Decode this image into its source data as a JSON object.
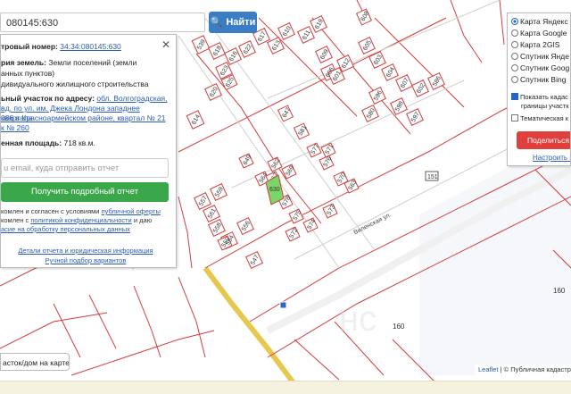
{
  "search": {
    "value": "080145:630",
    "button_label": "Найти"
  },
  "info_panel": {
    "cadastral_label": "тровый номер:",
    "cadastral_value": "34:34:080145:630",
    "category_label": "рия земель:",
    "category_value": "Земли поселений (земли",
    "category_value2": "анных пунктов)",
    "usage_value": "дивидуального жилищного строительства",
    "address_label": "ьный участок по адресу:",
    "address_line1": "обл. Волгоградская, г",
    "address_line2": "ад, по ул. им. Джека Лондона западнее квартала",
    "address_line3": "086 в Красноармейском районе, квартал № 21",
    "address_line4": "к № 260",
    "area_label": "енная площадь:",
    "area_value": "718 кв.м.",
    "email_placeholder": "u email, куда отправить отчет",
    "report_button": "Получить подробный отчет",
    "consent1": "комлен и согласен с условиями",
    "consent1_link": "публичной оферты",
    "consent2": "комлен с",
    "consent2_link": "политикой конфиденциальности",
    "consent2_tail": "и даю",
    "consent3_link": "асие на обработку персональных данных",
    "details_link": "Детали отчета и юридическая информация",
    "manual_link": "Ручной подбор вариантов"
  },
  "layers": {
    "options": [
      "Карта Яндекс",
      "Карта Google",
      "Карта 2GIS",
      "Спутник Янде",
      "Спутник Goog",
      "Спутник Bing"
    ],
    "selected": 0,
    "check1_line1": "Показать кадас",
    "check1_line2": "границы участк",
    "check2": "Тематическая к",
    "share_button": "Поделиться сс",
    "setup_link": "Настроить карт"
  },
  "question_button": "асток/дом на карте?",
  "attribution": {
    "leaflet": "Leaflet",
    "rest": "| © Публичная кадастр"
  },
  "map": {
    "road_label": "Виленская ул.",
    "road_badge": "151",
    "big_labels": [
      "160",
      "160"
    ],
    "selected_plot": "630",
    "plots": [
      "539",
      "618",
      "616",
      "623",
      "625",
      "620",
      "614",
      "610",
      "622",
      "617",
      "613",
      "611",
      "619",
      "609",
      "606",
      "612",
      "608",
      "605",
      "603",
      "604",
      "607",
      "602",
      "586",
      "601",
      "596",
      "598",
      "597",
      "580",
      "581",
      "577",
      "576",
      "570",
      "563",
      "571",
      "564",
      "562",
      "569",
      "567",
      "578",
      "575",
      "573",
      "574",
      "572",
      "649",
      "647",
      "559",
      "557",
      "561",
      "558",
      "554",
      "556",
      "550",
      "547"
    ]
  },
  "colors": {
    "selected_fill": "#7bd66a",
    "plot_border": "#d23c3c",
    "road": "#e6c84e",
    "search_button": "#3a7dc4",
    "report_button": "#3aa84a",
    "share_button": "#e0403c"
  }
}
